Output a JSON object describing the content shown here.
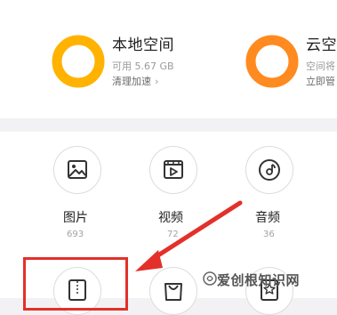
{
  "storage": {
    "local": {
      "title": "本地空间",
      "available": "可用 5.67 GB",
      "action": "清理加速",
      "ring_color": "#ffb300"
    },
    "cloud": {
      "title": "云空",
      "line1": "空间将",
      "line2": "立即管",
      "ring_color": "#ff8a1f"
    }
  },
  "categories": [
    {
      "label": "图片",
      "count": "693",
      "icon": "image-icon"
    },
    {
      "label": "视频",
      "count": "72",
      "icon": "video-icon"
    },
    {
      "label": "音频",
      "count": "36",
      "icon": "music-icon"
    }
  ],
  "second_row_icons": [
    "zip-icon",
    "bag-icon",
    "star-doc-icon"
  ],
  "annotation": {
    "color": "#e3302a"
  },
  "watermark": {
    "text": "爱创根知识网"
  }
}
